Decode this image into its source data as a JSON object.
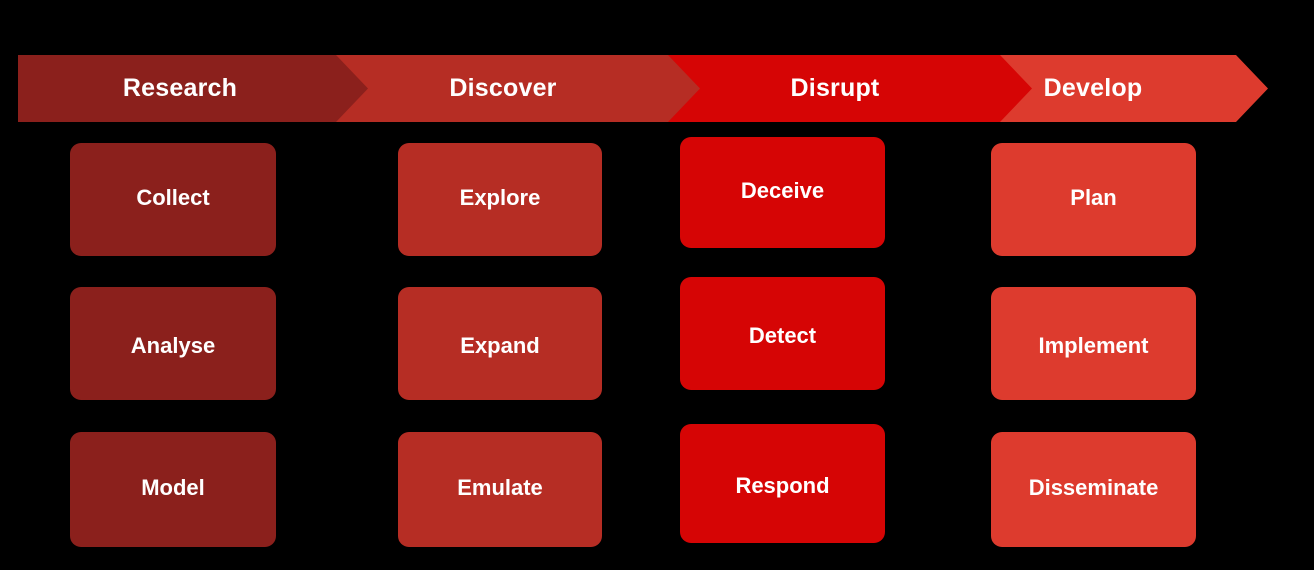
{
  "diagram": {
    "title": "Research Discover Disrupt Develop phase model",
    "background_color": "#000000",
    "text_color": "#ffffff"
  },
  "phases": [
    {
      "key": "research",
      "label": "Research",
      "color": "#8B201C"
    },
    {
      "key": "discover",
      "label": "Discover",
      "color": "#B62D24"
    },
    {
      "key": "disrupt",
      "label": "Disrupt",
      "color": "#D60505"
    },
    {
      "key": "develop",
      "label": "Develop",
      "color": "#DD3B2E"
    }
  ],
  "columns": [
    {
      "phase": "Research",
      "color": "#8B201C",
      "cards": [
        "Collect",
        "Analyse",
        "Model"
      ]
    },
    {
      "phase": "Discover",
      "color": "#B62D24",
      "cards": [
        "Explore",
        "Expand",
        "Emulate"
      ]
    },
    {
      "phase": "Disrupt",
      "color": "#D60505",
      "cards": [
        "Deceive",
        "Detect",
        "Respond"
      ]
    },
    {
      "phase": "Develop",
      "color": "#DD3B2E",
      "cards": [
        "Plan",
        "Implement",
        "Disseminate"
      ]
    }
  ]
}
